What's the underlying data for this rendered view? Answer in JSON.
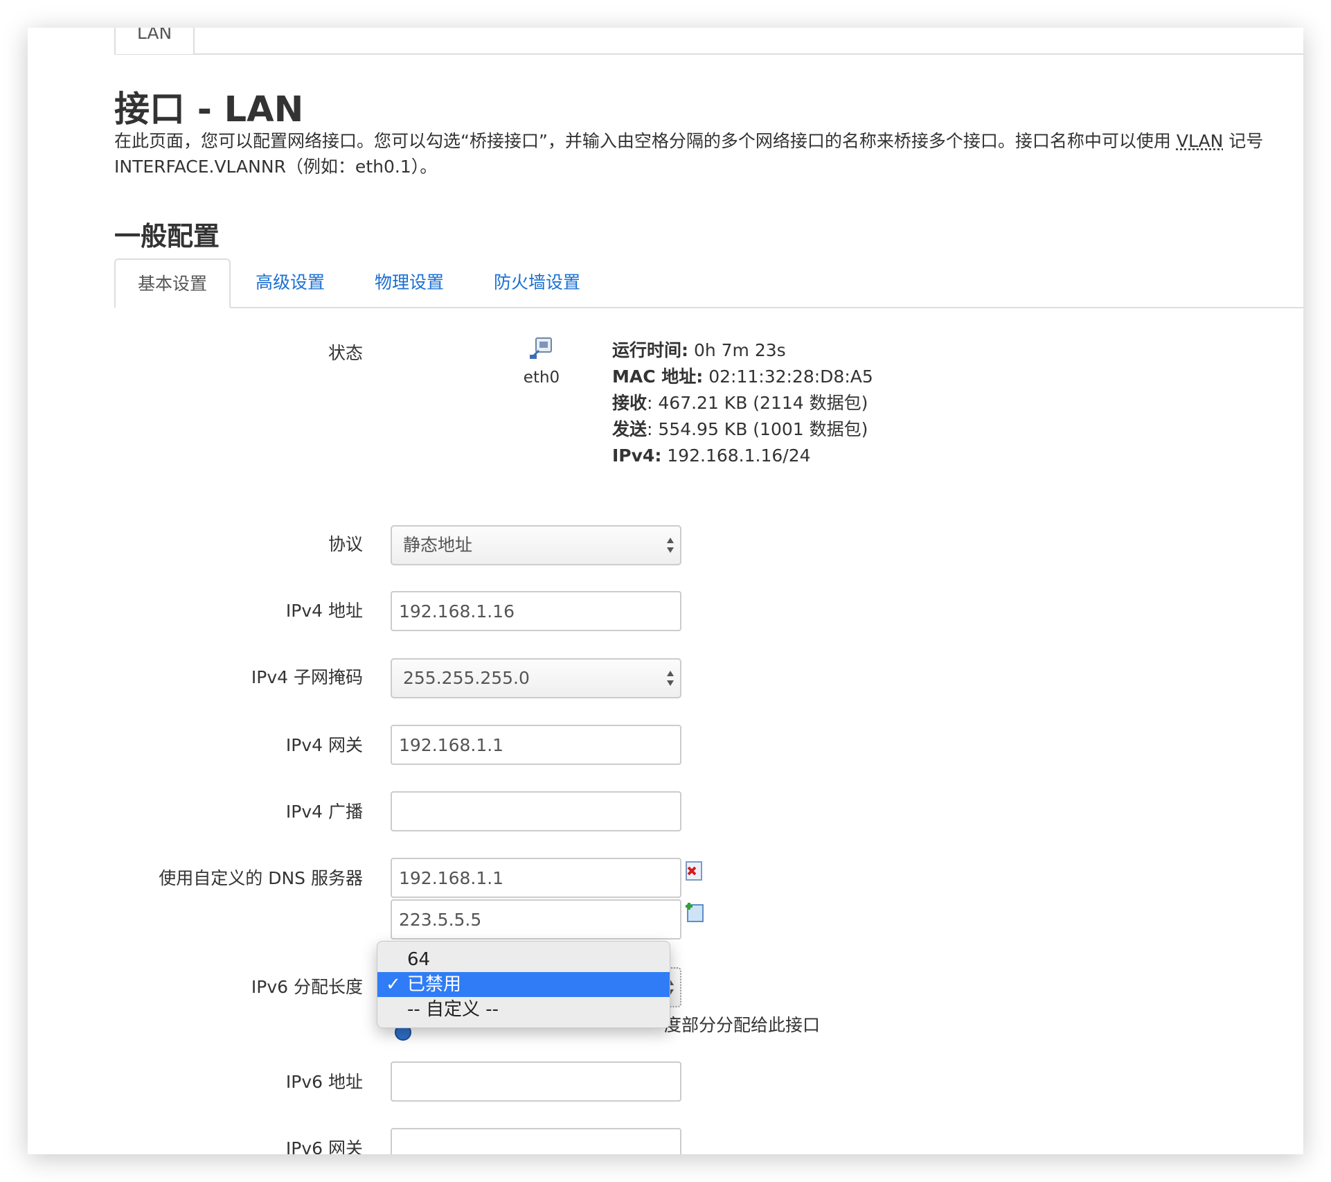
{
  "top_tab": {
    "label": "LAN"
  },
  "page_title": "接口 - LAN",
  "description": {
    "before": "在此页面，您可以配置网络接口。您可以勾选“桥接接口”，并输入由空格分隔的多个网络接口的名称来桥接多个接口。接口名称中可以使用 ",
    "abbr": "VLAN",
    "after": " 记号 INTERFACE.VLANNR（例如：eth0.1）。"
  },
  "section_title": "一般配置",
  "tabs": [
    {
      "label": "基本设置",
      "active": true
    },
    {
      "label": "高级设置"
    },
    {
      "label": "物理设置"
    },
    {
      "label": "防火墙设置"
    }
  ],
  "status": {
    "label": "状态",
    "device": "eth0",
    "icon": "ethernet-port-icon",
    "lines": [
      {
        "key": "运行时间:",
        "value": " 0h 7m 23s"
      },
      {
        "key": "MAC 地址:",
        "value": " 02:11:32:28:D8:A5"
      },
      {
        "key": "接收",
        "value": ": 467.21 KB (2114 数据包)"
      },
      {
        "key": "发送",
        "value": ": 554.95 KB (1001 数据包)"
      },
      {
        "key": "IPv4:",
        "value": " 192.168.1.16/24"
      }
    ]
  },
  "fields": {
    "protocol": {
      "label": "协议",
      "value": "静态地址"
    },
    "ipv4_addr": {
      "label": "IPv4 地址",
      "value": "192.168.1.16"
    },
    "ipv4_netmask": {
      "label": "IPv4 子网掩码",
      "value": "255.255.255.0"
    },
    "ipv4_gateway": {
      "label": "IPv4 网关",
      "value": "192.168.1.1"
    },
    "ipv4_broadcast": {
      "label": "IPv4 广播",
      "value": ""
    },
    "dns": {
      "label": "使用自定义的 DNS 服务器",
      "values": [
        "192.168.1.1",
        "223.5.5.5"
      ],
      "remove_icon": "remove-entry-icon",
      "add_icon": "add-entry-icon"
    },
    "ipv6_assign": {
      "label": "IPv6 分配长度",
      "options": [
        "64",
        "已禁用",
        "-- 自定义 --"
      ],
      "selected": "已禁用",
      "hint": "度部分分配给此接口"
    },
    "ipv6_addr": {
      "label": "IPv6 地址",
      "value": ""
    },
    "ipv6_gateway": {
      "label": "IPv6 网关",
      "value": ""
    }
  },
  "colors": {
    "link": "#1a6fd2",
    "selected": "#2f7cf6"
  }
}
